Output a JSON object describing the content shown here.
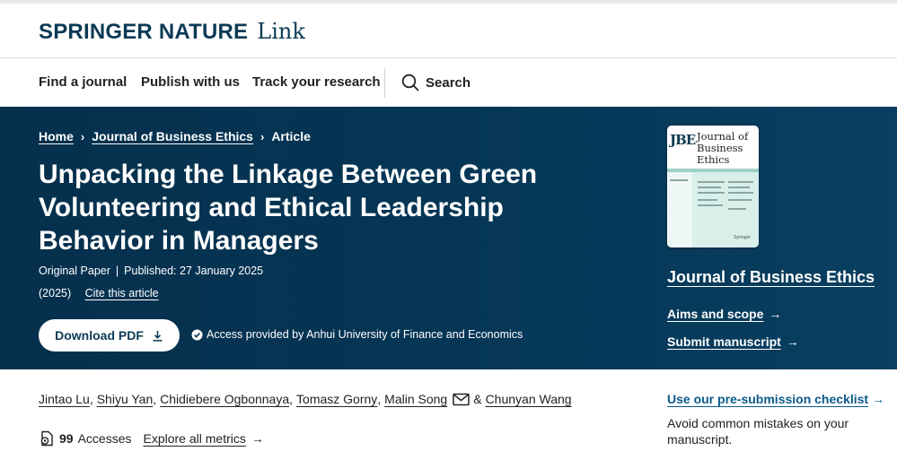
{
  "header": {
    "brand": "SPRINGER NATURE",
    "brand_suffix": "Link"
  },
  "nav": {
    "items": [
      "Find a journal",
      "Publish with us",
      "Track your research"
    ],
    "search_label": "Search"
  },
  "breadcrumb": {
    "home": "Home",
    "journal": "Journal of Business Ethics",
    "current": "Article",
    "separator": "›"
  },
  "article": {
    "title": "Unpacking the Linkage Between Green Volunteering and Ethical Leadership Behavior in Managers",
    "type": "Original Paper",
    "published": "Published: 27 January 2025",
    "year": "(2025)",
    "cite_label": "Cite this article",
    "download_label": "Download PDF",
    "access_text": "Access provided by Anhui University of Finance and Economics"
  },
  "journal_card": {
    "cover_logo": "JBE",
    "cover_title_lines": [
      "Journal of",
      "Business",
      "Ethics"
    ],
    "cover_publisher": "Springer",
    "name": "Journal of Business Ethics",
    "aims_label": "Aims and scope",
    "submit_label": "Submit manuscript",
    "arrow": "→"
  },
  "authors": {
    "list": [
      "Jintao Lu",
      "Shiyu Yan",
      "Chidiebere Ogbonnaya",
      "Tomasz Gorny",
      "Malin Song"
    ],
    "last": "Chunyan Wang",
    "separator": ",",
    "ampersand": "&"
  },
  "metrics": {
    "accesses_count": "99",
    "accesses_label": "Accesses",
    "explore_label": "Explore all metrics",
    "arrow": "→"
  },
  "sidebar": {
    "checklist_label": "Use our pre-submission checklist",
    "checklist_desc": "Avoid common mistakes on your manuscript.",
    "arrow": "→"
  },
  "colors": {
    "hero_bg": "#053655",
    "brand": "#0b3a55",
    "link": "#0b5a8a"
  },
  "icons": [
    "search-icon",
    "download-icon",
    "check-circle-icon",
    "envelope-icon",
    "accesses-icon",
    "arrow-right-icon"
  ]
}
